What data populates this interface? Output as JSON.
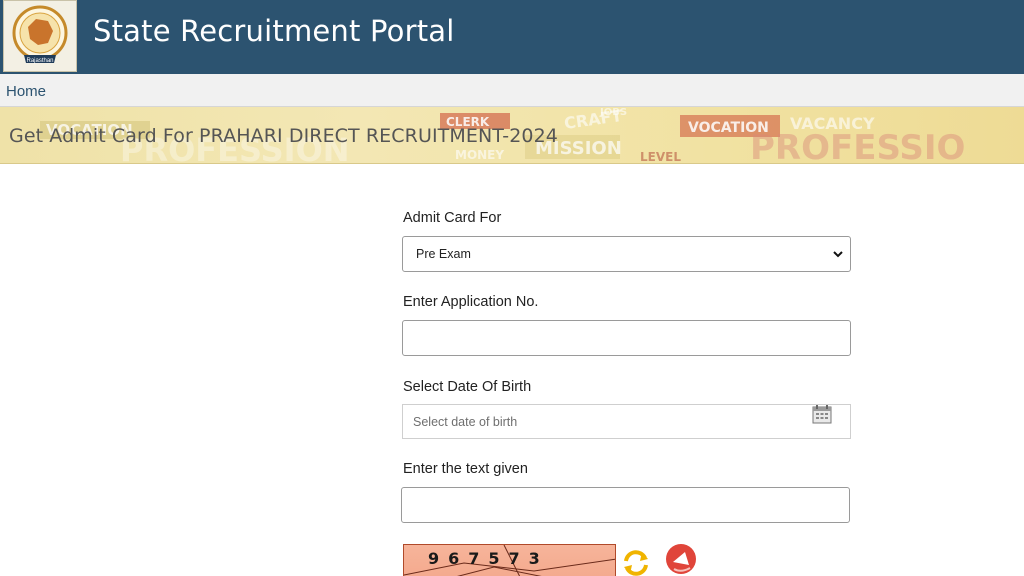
{
  "header": {
    "title": "State Recruitment Portal",
    "logo_text": "Rajasthan"
  },
  "nav": {
    "home": "Home"
  },
  "banner": {
    "title": "Get Admit Card For PRAHARI DIRECT RECRUITMENT-2024",
    "bg_words": [
      "VOCATION",
      "CLERK",
      "CRAFT",
      "MISSION",
      "VOCATION",
      "VACANCY",
      "PROFESSION",
      "PROFESSIO",
      "LEVEL",
      "MONEY",
      "JOBS"
    ]
  },
  "form": {
    "admit_card_label": "Admit Card For",
    "admit_card_value": "Pre Exam",
    "application_label": "Enter Application No.",
    "application_value": "",
    "dob_label": "Select Date Of Birth",
    "dob_placeholder": "Select date of birth",
    "captcha_label": "Enter the text given",
    "captcha_value": "",
    "captcha_text": "967573"
  },
  "icons": {
    "calendar": "calendar-icon",
    "refresh": "refresh-icon",
    "audio": "audio-icon",
    "chevron": "chevron-down-icon"
  },
  "colors": {
    "header_bg": "#2c5370",
    "banner_bg": "#f1e2a2",
    "captcha_bg": "#f4a88c",
    "audio_red": "#e0453a",
    "refresh_yellow": "#f0b400"
  }
}
